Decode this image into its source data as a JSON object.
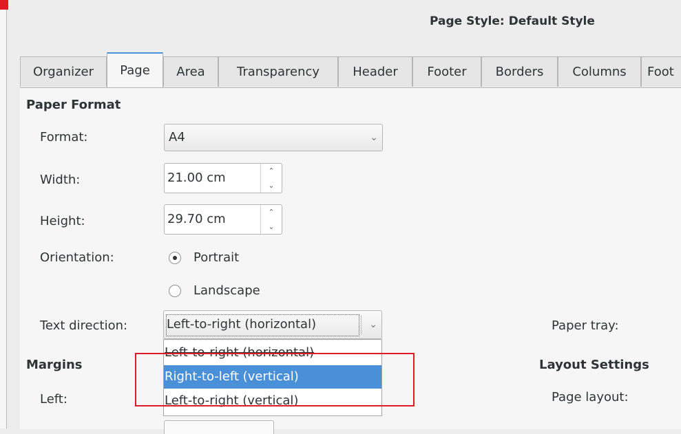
{
  "window": {
    "title": "Page Style: Default Style"
  },
  "tabs": [
    {
      "label": "Organizer"
    },
    {
      "label": "Page"
    },
    {
      "label": "Area"
    },
    {
      "label": "Transparency"
    },
    {
      "label": "Header"
    },
    {
      "label": "Footer"
    },
    {
      "label": "Borders"
    },
    {
      "label": "Columns"
    },
    {
      "label": "Foot"
    }
  ],
  "paper_format": {
    "title": "Paper Format",
    "format_label": "Format:",
    "format_value": "A4",
    "width_label": "Width:",
    "width_value": "21.00 cm",
    "height_label": "Height:",
    "height_value": "29.70 cm",
    "orientation_label": "Orientation:",
    "portrait": "Portrait",
    "landscape": "Landscape",
    "orientation_selected": "Portrait",
    "text_direction_label": "Text direction:",
    "text_direction_value": "Left-to-right (horizontal)",
    "paper_tray_label": "Paper tray:"
  },
  "dropdown": {
    "options": [
      "Left-to-right (horizontal)",
      "Right-to-left (vertical)",
      "Left-to-right (vertical)"
    ],
    "highlighted": "Right-to-left (vertical)"
  },
  "margins": {
    "title": "Margins",
    "left_label": "Left:"
  },
  "layout_settings": {
    "title": "Layout Settings",
    "page_layout_label": "Page layout:"
  },
  "colors": {
    "accent": "#4a90d9",
    "annotation": "#e01b24"
  }
}
